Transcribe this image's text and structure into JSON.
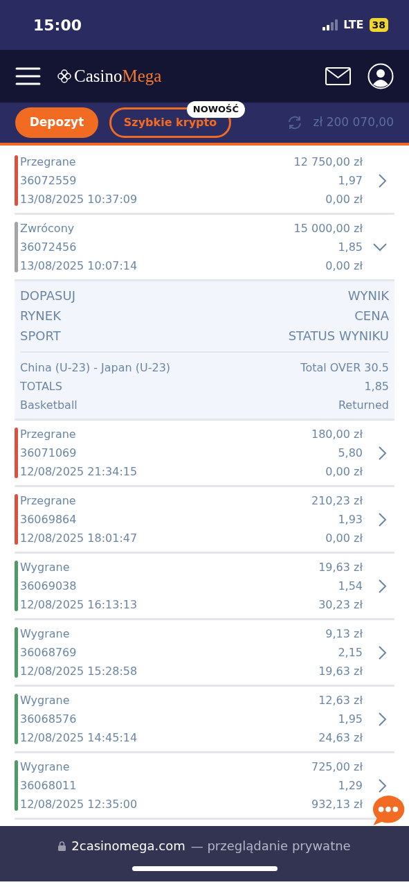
{
  "status_bar": {
    "time": "15:00",
    "network": "LTE",
    "battery": "38"
  },
  "header": {
    "logo_first": "Casino",
    "logo_second": "Mega"
  },
  "toolbar": {
    "deposit_button": "Depozyt",
    "crypto_button": "Szybkie krypto",
    "new_badge": "NOWOŚĆ",
    "balance": "zł 200 070,00"
  },
  "bets": [
    {
      "status": "Przegrane",
      "color": "#d9513f",
      "id": "36072559",
      "datetime": "13/08/2025 10:37:09",
      "stake": "12 750,00 zł",
      "odds": "1,97",
      "payout": "0,00 zł",
      "expanded": false
    },
    {
      "status": "Zwrócony",
      "color": "#a5a5a5",
      "id": "36072456",
      "datetime": "13/08/2025 10:07:14",
      "stake": "15 000,00 zł",
      "odds": "1,85",
      "payout": "0,00 zł",
      "expanded": true,
      "details": {
        "headers": [
          [
            "DOPASUJ",
            "WYNIK"
          ],
          [
            "RYNEK",
            "CENA"
          ],
          [
            "SPORT",
            "STATUS WYNIKU"
          ]
        ],
        "values": [
          [
            "China (U-23) - Japan (U-23)",
            "Total OVER 30.5"
          ],
          [
            "TOTALS",
            "1,85"
          ],
          [
            "Basketball",
            "Returned"
          ]
        ]
      }
    },
    {
      "status": "Przegrane",
      "color": "#d9513f",
      "id": "36071069",
      "datetime": "12/08/2025 21:34:15",
      "stake": "180,00 zł",
      "odds": "5,80",
      "payout": "0,00 zł",
      "expanded": false
    },
    {
      "status": "Przegrane",
      "color": "#d9513f",
      "id": "36069864",
      "datetime": "12/08/2025 18:01:47",
      "stake": "210,23 zł",
      "odds": "1,93",
      "payout": "0,00 zł",
      "expanded": false
    },
    {
      "status": "Wygrane",
      "color": "#4e9a6b",
      "id": "36069038",
      "datetime": "12/08/2025 16:13:13",
      "stake": "19,63 zł",
      "odds": "1,54",
      "payout": "30,23 zł",
      "expanded": false
    },
    {
      "status": "Wygrane",
      "color": "#4e9a6b",
      "id": "36068769",
      "datetime": "12/08/2025 15:28:58",
      "stake": "9,13 zł",
      "odds": "2,15",
      "payout": "19,63 zł",
      "expanded": false
    },
    {
      "status": "Wygrane",
      "color": "#4e9a6b",
      "id": "36068576",
      "datetime": "12/08/2025 14:45:14",
      "stake": "12,63 zł",
      "odds": "1,95",
      "payout": "24,63 zł",
      "expanded": false
    },
    {
      "status": "Wygrane",
      "color": "#4e9a6b",
      "id": "36068011",
      "datetime": "12/08/2025 12:35:00",
      "stake": "725,00 zł",
      "odds": "1,29",
      "payout": "932,13 zł",
      "expanded": false
    }
  ],
  "browser_bar": {
    "domain": "2casinomega.com",
    "note": "— przeglądanie prywatne"
  }
}
